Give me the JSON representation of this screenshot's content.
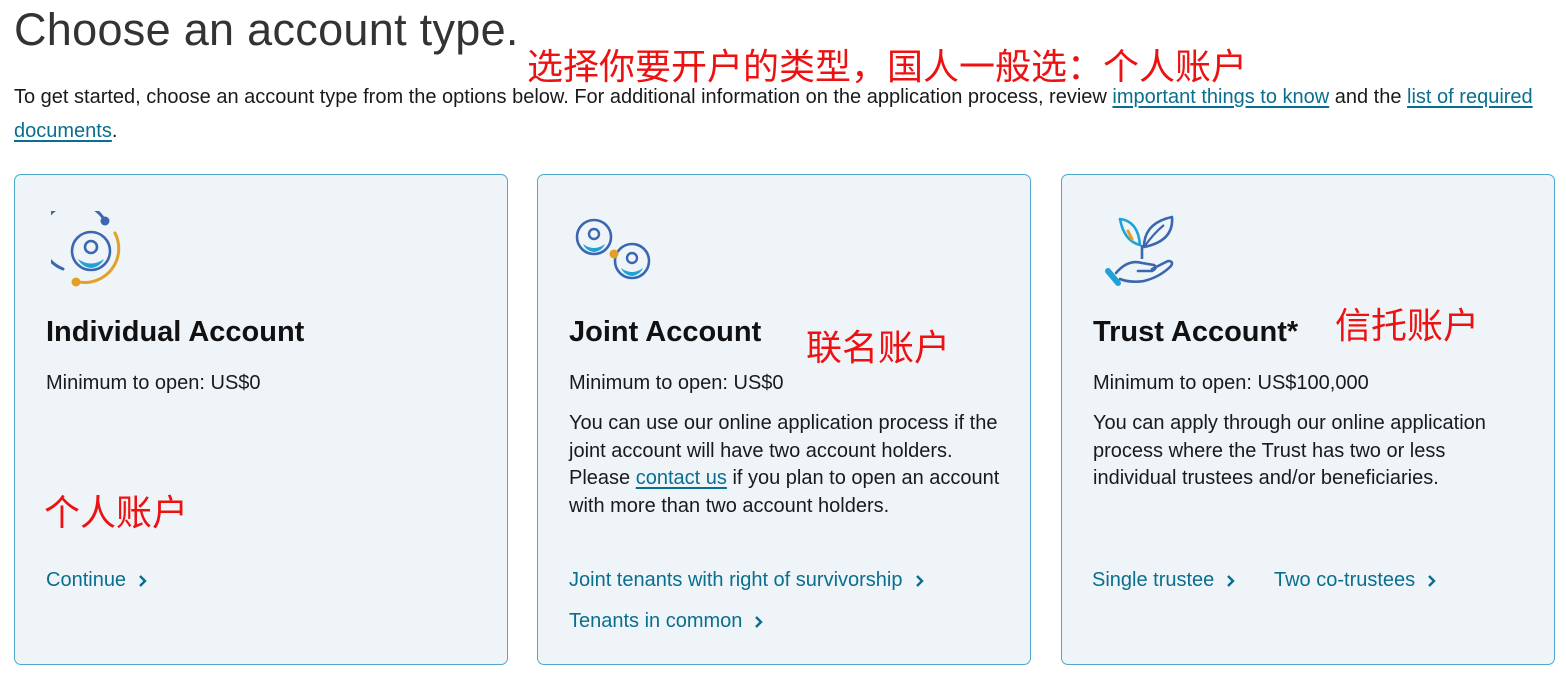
{
  "page": {
    "title": "Choose an account type.",
    "intro_text": "To get started, choose an account type from the options below. For additional information on the application process, review ",
    "intro_link1": "important things to know",
    "intro_mid": " and the ",
    "intro_link2": "list of required documents",
    "intro_end": "."
  },
  "annotations": {
    "top": "选择你要开户的类型，国人一般选：个人账户",
    "individual": "个人账户",
    "joint": "联名账户",
    "trust": "信托账户"
  },
  "cards": {
    "individual": {
      "title": "Individual Account",
      "minimum": "Minimum to open: US$0",
      "actions": [
        "Continue"
      ],
      "icon": "person-orbit-icon"
    },
    "joint": {
      "title": "Joint Account",
      "minimum": "Minimum to open: US$0",
      "desc_before": "You can use our online application process if the joint account will have two account holders. Please ",
      "desc_link": "contact us",
      "desc_after": " if you plan to open an account with more than two account holders.",
      "actions": [
        "Joint tenants with right of survivorship",
        "Tenants in common"
      ],
      "icon": "two-people-icon"
    },
    "trust": {
      "title": "Trust Account*",
      "minimum": "Minimum to open: US$100,000",
      "desc": "You can apply through our online application process where the Trust has two or less individual trustees and/or beneficiaries.",
      "actions": [
        "Single trustee",
        "Two co-trustees"
      ],
      "icon": "hand-leaf-icon"
    }
  },
  "colors": {
    "link": "#0a6e8f",
    "card_bg": "#eef4f8",
    "card_border": "#4fa7cc",
    "icon_blue": "#3a67b0",
    "icon_cyan": "#1fa2d6",
    "icon_orange": "#e3a024",
    "annotation": "#ee1111"
  }
}
